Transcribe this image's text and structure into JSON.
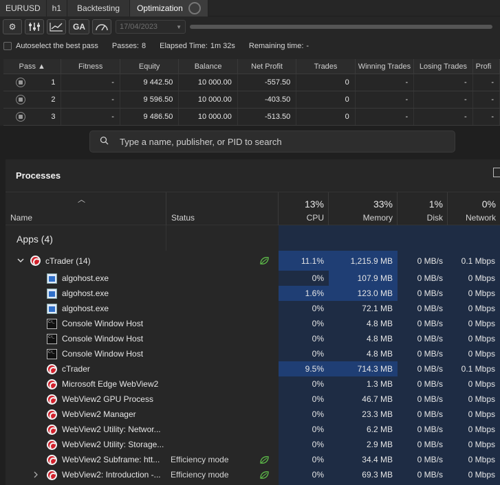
{
  "ctrader": {
    "tabs": [
      {
        "label": "EURUSD"
      },
      {
        "label": "h1"
      },
      {
        "label": "Backtesting"
      },
      {
        "label": "Optimization"
      }
    ],
    "toolbar": {
      "ga_label": "GA",
      "date": "17/04/2023"
    },
    "status": {
      "autoselect_label": "Autoselect the best pass",
      "passes_label": "Passes:",
      "passes_value": "8",
      "elapsed_label": "Elapsed Time:",
      "elapsed_value": "1m 32s",
      "remaining_label": "Remaining time:",
      "remaining_value": "-"
    },
    "table": {
      "headers": [
        "Pass ▲",
        "Fitness",
        "Equity",
        "Balance",
        "Net Profit",
        "Trades",
        "Winning Trades",
        "Losing Trades",
        "Profi"
      ],
      "rows": [
        [
          "1",
          "-",
          "9 442.50",
          "10 000.00",
          "-557.50",
          "0",
          "-",
          "-",
          "-"
        ],
        [
          "2",
          "-",
          "9 596.50",
          "10 000.00",
          "-403.50",
          "0",
          "-",
          "-",
          "-"
        ],
        [
          "3",
          "-",
          "9 486.50",
          "10 000.00",
          "-513.50",
          "0",
          "-",
          "-",
          "-"
        ]
      ]
    }
  },
  "taskmanager": {
    "search_placeholder": "Type a name, publisher, or PID to search",
    "title": "Processes",
    "columns": {
      "name": "Name",
      "status": "Status",
      "cpu_pct": "13%",
      "cpu": "CPU",
      "mem_pct": "33%",
      "mem": "Memory",
      "disk_pct": "1%",
      "disk": "Disk",
      "net_pct": "0%",
      "net": "Network"
    },
    "group_label": "Apps (4)",
    "parent": {
      "name": "cTrader (14)",
      "cpu": "11.1%",
      "mem": "1,215.9 MB",
      "disk": "0 MB/s",
      "net": "0.1 Mbps"
    },
    "rows": [
      {
        "icon": "win",
        "name": "algohost.exe",
        "status": "",
        "cpu": "0%",
        "mem": "107.9 MB",
        "disk": "0 MB/s",
        "net": "0 Mbps"
      },
      {
        "icon": "win",
        "name": "algohost.exe",
        "status": "",
        "cpu": "1.6%",
        "mem": "123.0 MB",
        "disk": "0 MB/s",
        "net": "0 Mbps"
      },
      {
        "icon": "win",
        "name": "algohost.exe",
        "status": "",
        "cpu": "0%",
        "mem": "72.1 MB",
        "disk": "0 MB/s",
        "net": "0 Mbps"
      },
      {
        "icon": "con",
        "name": "Console Window Host",
        "status": "",
        "cpu": "0%",
        "mem": "4.8 MB",
        "disk": "0 MB/s",
        "net": "0 Mbps"
      },
      {
        "icon": "con",
        "name": "Console Window Host",
        "status": "",
        "cpu": "0%",
        "mem": "4.8 MB",
        "disk": "0 MB/s",
        "net": "0 Mbps"
      },
      {
        "icon": "con",
        "name": "Console Window Host",
        "status": "",
        "cpu": "0%",
        "mem": "4.8 MB",
        "disk": "0 MB/s",
        "net": "0 Mbps"
      },
      {
        "icon": "ct",
        "name": "cTrader",
        "status": "",
        "cpu": "9.5%",
        "mem": "714.3 MB",
        "disk": "0 MB/s",
        "net": "0.1 Mbps"
      },
      {
        "icon": "ct",
        "name": "Microsoft Edge WebView2",
        "status": "",
        "cpu": "0%",
        "mem": "1.3 MB",
        "disk": "0 MB/s",
        "net": "0 Mbps"
      },
      {
        "icon": "ct",
        "name": "WebView2 GPU Process",
        "status": "",
        "cpu": "0%",
        "mem": "46.7 MB",
        "disk": "0 MB/s",
        "net": "0 Mbps"
      },
      {
        "icon": "ct",
        "name": "WebView2 Manager",
        "status": "",
        "cpu": "0%",
        "mem": "23.3 MB",
        "disk": "0 MB/s",
        "net": "0 Mbps"
      },
      {
        "icon": "ct",
        "name": "WebView2 Utility: Networ...",
        "status": "",
        "cpu": "0%",
        "mem": "6.2 MB",
        "disk": "0 MB/s",
        "net": "0 Mbps"
      },
      {
        "icon": "ct",
        "name": "WebView2 Utility: Storage...",
        "status": "",
        "cpu": "0%",
        "mem": "2.9 MB",
        "disk": "0 MB/s",
        "net": "0 Mbps"
      },
      {
        "icon": "ct",
        "name": "WebView2 Subframe: htt...",
        "status": "Efficiency mode",
        "cpu": "0%",
        "mem": "34.4 MB",
        "disk": "0 MB/s",
        "net": "0 Mbps"
      },
      {
        "icon": "ct",
        "name": "WebView2: Introduction -...",
        "status": "Efficiency mode",
        "cpu": "0%",
        "mem": "69.3 MB",
        "disk": "0 MB/s",
        "net": "0 Mbps"
      }
    ]
  }
}
